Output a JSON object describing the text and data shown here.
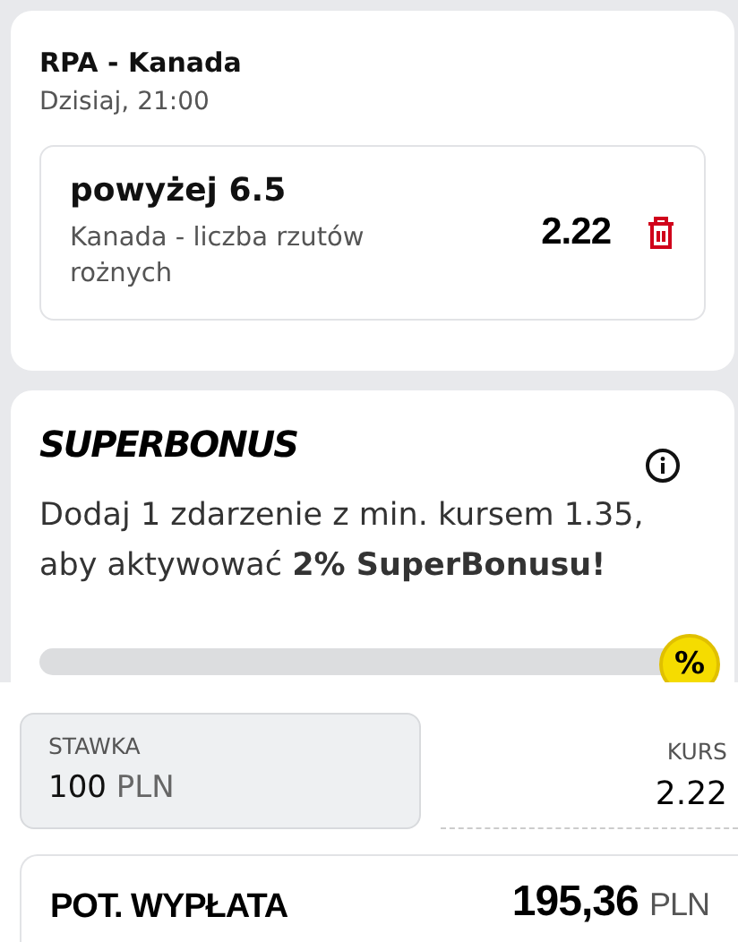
{
  "event": {
    "title": "RPA - Kanada",
    "time": "Dzisiaj, 21:00"
  },
  "selection": {
    "pick": "powyżej 6.5",
    "market": "Kanada - liczba rzutów rożnych",
    "odds": "2.22"
  },
  "superbonus": {
    "title": "SUPERBONUS",
    "text": "Dodaj 1 zdarzenie z min. kursem 1.35, aby aktywować **2% SuperBonusu!**",
    "badge": "%"
  },
  "stake": {
    "label": "STAWKA",
    "value": "100",
    "currency": "PLN"
  },
  "odds": {
    "label": "KURS",
    "value": "2.22"
  },
  "payout": {
    "label": "POT. WYPŁATA",
    "value": "195,36",
    "currency": "PLN"
  }
}
